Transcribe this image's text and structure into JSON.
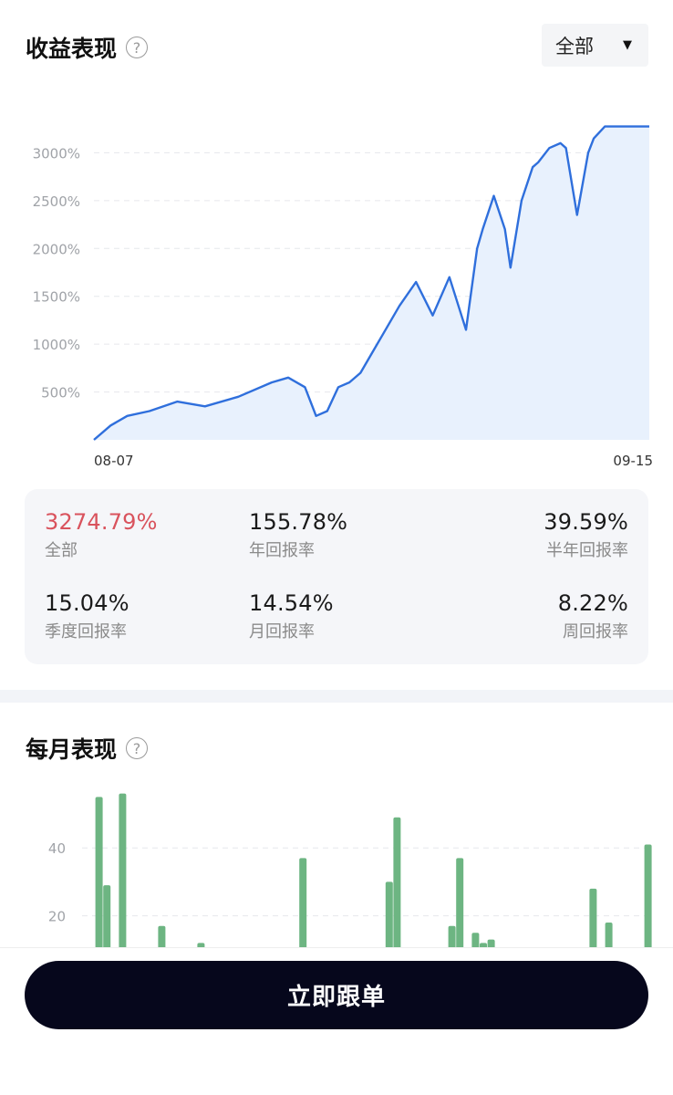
{
  "performance": {
    "title": "收益表现",
    "help_icon": "?",
    "range_select": {
      "value": "全部",
      "caret": "▼"
    }
  },
  "stats": [
    {
      "value": "3274.79%",
      "label": "全部",
      "color": "#d9535d"
    },
    {
      "value": "155.78%",
      "label": "年回报率"
    },
    {
      "value": "39.59%",
      "label": "半年回报率"
    },
    {
      "value": "15.04%",
      "label": "季度回报率"
    },
    {
      "value": "14.54%",
      "label": "月回报率"
    },
    {
      "value": "8.22%",
      "label": "周回报率"
    }
  ],
  "monthly": {
    "title": "每月表现",
    "help_icon": "?"
  },
  "follow_button": {
    "label": "立即跟单"
  },
  "colors": {
    "line": "#2f6fdc",
    "area": "#e8f1fd",
    "bar": "#6db582",
    "accent_red": "#d9535d"
  },
  "chart_data": [
    {
      "type": "area",
      "title": "",
      "x_tick_labels": [
        "08-07",
        "09-15"
      ],
      "y_tick_labels": [
        "500%",
        "1000%",
        "1500%",
        "2000%",
        "2500%",
        "3000%"
      ],
      "y_ticks": [
        500,
        1000,
        1500,
        2000,
        2500,
        3000
      ],
      "ylim": [
        0,
        3500
      ],
      "grid": true,
      "x": [
        0,
        0.03,
        0.06,
        0.1,
        0.15,
        0.2,
        0.26,
        0.32,
        0.35,
        0.38,
        0.4,
        0.42,
        0.44,
        0.46,
        0.48,
        0.5,
        0.52,
        0.55,
        0.58,
        0.61,
        0.64,
        0.67,
        0.69,
        0.7,
        0.72,
        0.74,
        0.75,
        0.77,
        0.79,
        0.8,
        0.82,
        0.84,
        0.85,
        0.87,
        0.89,
        0.9,
        0.92,
        0.94,
        0.96,
        0.98,
        0.99,
        1.0
      ],
      "y": [
        0,
        150,
        250,
        300,
        400,
        350,
        450,
        600,
        650,
        550,
        250,
        300,
        550,
        600,
        700,
        900,
        1100,
        1400,
        1650,
        1300,
        1700,
        1150,
        2000,
        2200,
        2550,
        2200,
        1800,
        2500,
        2850,
        2900,
        3050,
        3100,
        3050,
        2350,
        3000,
        3150,
        3274.79,
        3274.79,
        3274.79,
        3274.79,
        3274.79,
        3274.79
      ]
    },
    {
      "type": "bar",
      "title": "",
      "y_tick_labels": [
        "20",
        "40"
      ],
      "y_ticks": [
        20,
        40
      ],
      "ylim": [
        0,
        60
      ],
      "grid": true,
      "x": [
        0.01,
        0.02,
        0.04,
        0.09,
        0.14,
        0.27,
        0.38,
        0.39,
        0.46,
        0.47,
        0.49,
        0.5,
        0.51,
        0.64,
        0.66,
        0.71
      ],
      "values": [
        55,
        29,
        56,
        17,
        12,
        37,
        30,
        49,
        17,
        37,
        15,
        12,
        13,
        28,
        18,
        41
      ]
    }
  ]
}
